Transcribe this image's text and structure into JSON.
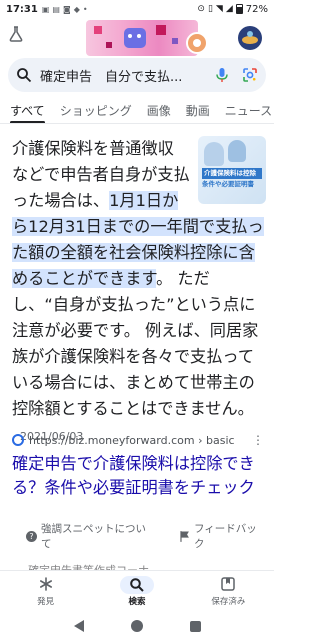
{
  "status_bar": {
    "time": "17:31",
    "notification_icons": [
      "app-icon",
      "bookmark-icon",
      "chat-icon",
      "bluesky-icon",
      "dot-icon"
    ],
    "battery": "72%"
  },
  "search": {
    "query": "確定申告　自分で支払..."
  },
  "tabs": [
    "すべて",
    "ショッピング",
    "画像",
    "動画",
    "ニュース"
  ],
  "snippet": {
    "text_before": "介護保険料を普通徴収などで申告者自身が支払った場合は、",
    "highlight": "1月1日から12月31日までの一年間で支払った額の全額を社会保険料控除に含めることができます",
    "text_after": "。 ただし、“自身が支払った”という点に注意が必要です。 例えば、同居家族が介護保険料を各々で支払っている場合には、まとめて世帯主の控除額とすることはできません。",
    "date": "2021/06/03",
    "thumbnail": {
      "label1": "介護保険料は控除",
      "label2": "条件や必要証明書"
    }
  },
  "result": {
    "source": "https://biz.moneyforward.com › basic",
    "title": "確定申告で介護保険料は控除できる？条件や必要証明書をチェック"
  },
  "feedback": {
    "about_label": "強調スニペットについて",
    "feedback_label": "フィードバック"
  },
  "peek_text": "確定申告書等作成コーナ",
  "bottom_nav": [
    {
      "label": "発見",
      "icon": "asterisk-icon"
    },
    {
      "label": "検索",
      "icon": "search-icon"
    },
    {
      "label": "保存済み",
      "icon": "bookmark-icon"
    }
  ],
  "colors": {
    "link": "#1a0dab",
    "highlight": "#d3e3fd",
    "search_bg": "#eef2f8"
  }
}
